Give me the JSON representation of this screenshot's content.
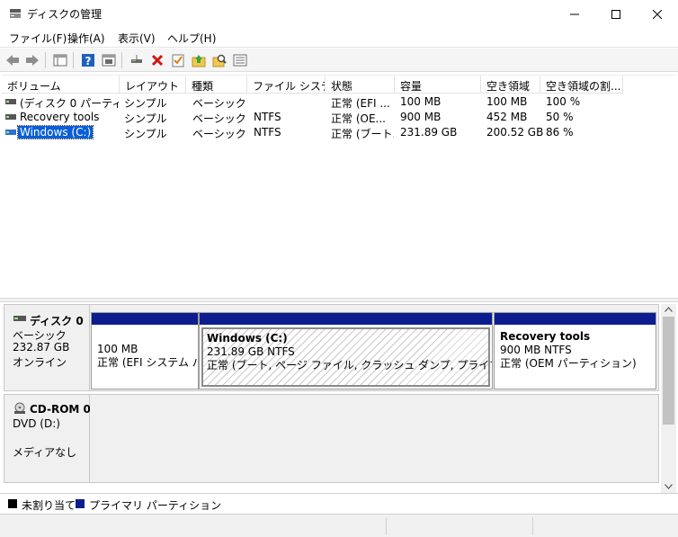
{
  "window": {
    "title": "ディスクの管理"
  },
  "menu": [
    "ファイル(F)",
    "操作(A)",
    "表示(V)",
    "ヘルプ(H)"
  ],
  "toolbar_icons": [
    "back-arrow-icon",
    "forward-arrow-icon",
    "properties-pane-icon",
    "help-icon",
    "console-tree-icon",
    "connect-disk-icon",
    "delete-icon",
    "checklist-icon",
    "up-folder-icon",
    "search-folder-icon",
    "list-view-icon"
  ],
  "volume_list": {
    "columns": [
      "ボリューム",
      "レイアウト",
      "種類",
      "ファイル システム",
      "状態",
      "容量",
      "空き領域",
      "空き領域の割..."
    ],
    "rows": [
      {
        "volume": "(ディスク 0 パーティシ...",
        "layout": "シンプル",
        "type": "ベーシック",
        "fs": "",
        "status": "正常 (EFI ...",
        "capacity": "100 MB",
        "free": "100 MB",
        "pct": "100 %"
      },
      {
        "volume": "Recovery tools",
        "layout": "シンプル",
        "type": "ベーシック",
        "fs": "NTFS",
        "status": "正常 (OE...",
        "capacity": "900 MB",
        "free": "452 MB",
        "pct": "50 %"
      },
      {
        "volume": "Windows (C:)",
        "layout": "シンプル",
        "type": "ベーシック",
        "fs": "NTFS",
        "status": "正常 (ブート...",
        "capacity": "231.89 GB",
        "free": "200.52 GB",
        "pct": "86 %"
      }
    ]
  },
  "disks": [
    {
      "name": "ディスク 0",
      "kind": "ベーシック",
      "size": "232.87 GB",
      "state": "オンライン",
      "partitions": [
        {
          "title": "",
          "line1": "100 MB",
          "line2": "正常 (EFI システム パー"
        },
        {
          "title": "Windows  (C:)",
          "line1": "231.89 GB NTFS",
          "line2": "正常 (ブート, ページ ファイル, クラッシュ ダンプ, プライマリ パーティション)"
        },
        {
          "title": "Recovery tools",
          "line1": "900 MB NTFS",
          "line2": "正常 (OEM パーティション)"
        }
      ]
    },
    {
      "name": "CD-ROM 0",
      "kind": "DVD (D:)",
      "blank": "",
      "state": "メディアなし"
    }
  ],
  "legend": [
    {
      "label": "未割り当て",
      "color": "#000000"
    },
    {
      "label": "プライマリ パーティション",
      "color": "#0c1e8f"
    }
  ],
  "colors": {
    "primary_partition": "#0c1e8f",
    "selection": "#0a5fd6"
  }
}
